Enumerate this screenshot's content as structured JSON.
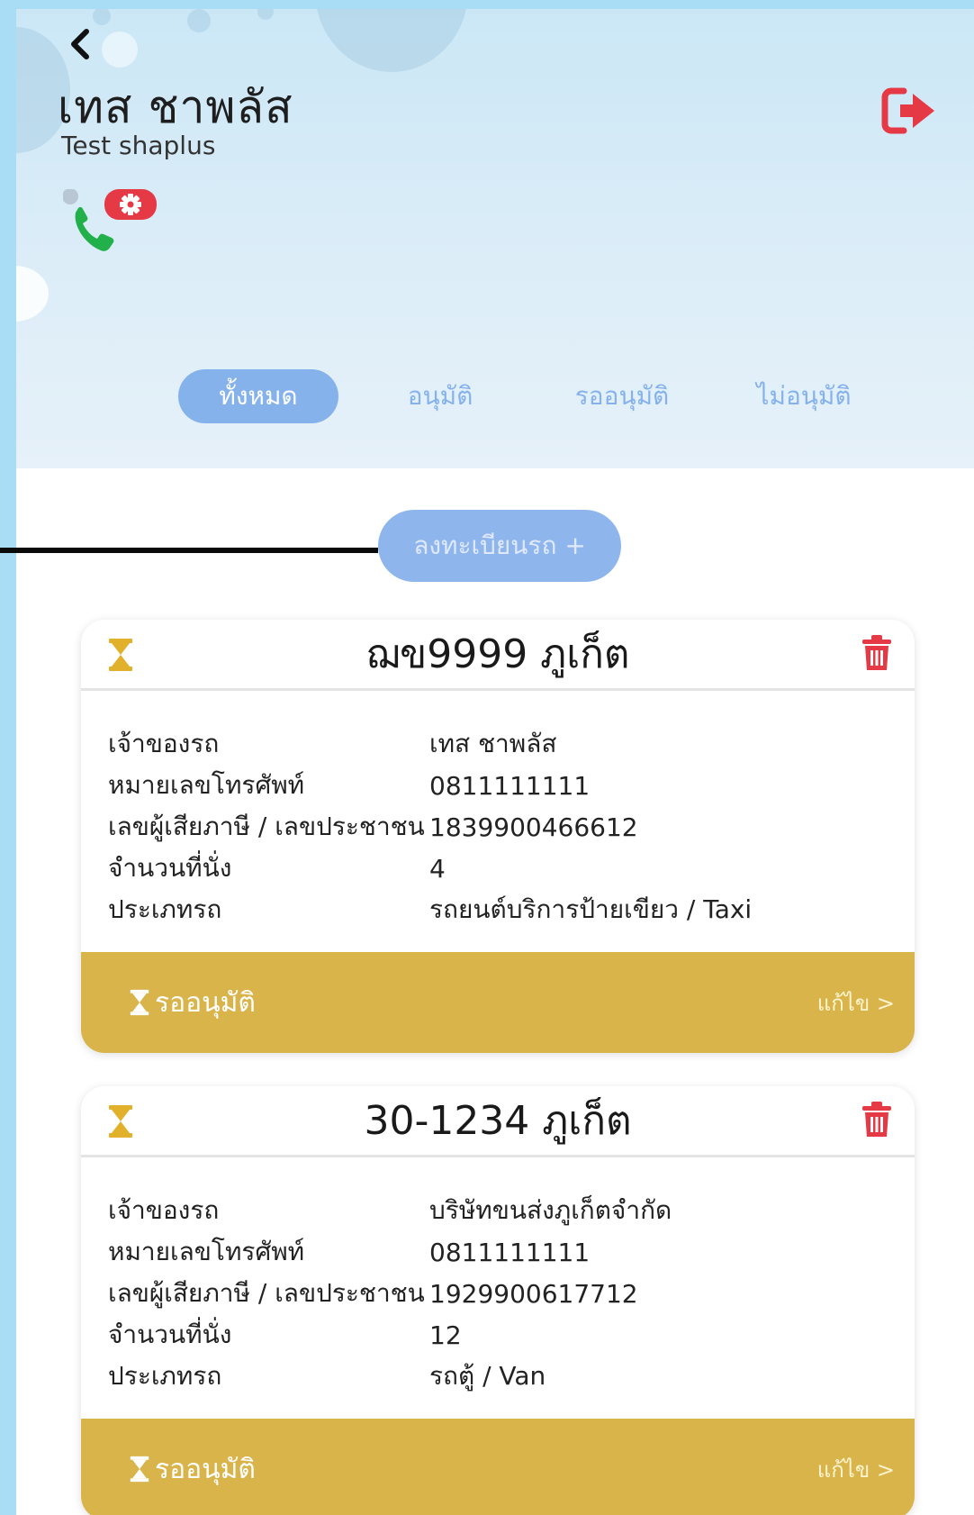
{
  "header": {
    "title": "เทส ชาพลัส",
    "subtitle": "Test shaplus"
  },
  "tabs": [
    {
      "label": "ทั้งหมด",
      "active": true
    },
    {
      "label": "อนุมัติ",
      "active": false
    },
    {
      "label": "รออนุมัติ",
      "active": false
    },
    {
      "label": "ไม่อนุมัติ",
      "active": false
    }
  ],
  "register_button": "ลงทะเบียนรถ +",
  "labels": {
    "owner": "เจ้าของรถ",
    "phone": "หมายเลขโทรศัพท์",
    "tax_id": "เลขผู้เสียภาษี / เลขประชาชน",
    "seats": "จำนวนที่นั่ง",
    "vehicle_type": "ประเภทรถ"
  },
  "vehicles": [
    {
      "plate": "ฌข9999 ภูเก็ต",
      "owner": "เทส ชาพลัส",
      "phone": "0811111111",
      "tax_id": "1839900466612",
      "seats": "4",
      "vehicle_type": "รถยนต์บริการป้ายเขียว / Taxi",
      "status": "รออนุมัติ",
      "edit": "แก้ไข >"
    },
    {
      "plate": "30-1234 ภูเก็ต",
      "owner": "บริษัทขนส่งภูเก็ตจำกัด",
      "phone": "0811111111",
      "tax_id": "1929900617712",
      "seats": "12",
      "vehicle_type": "รถตู้ / Van",
      "status": "รออนุมัติ",
      "edit": "แก้ไข >"
    }
  ],
  "colors": {
    "accent": "#86b2ec",
    "pending": "#d9b44a",
    "danger": "#e53945",
    "phone_green": "#21b04a"
  },
  "icons": {
    "back": "chevron-left-icon",
    "logout": "logout-icon",
    "call": "phone-icon",
    "settings": "gear-icon",
    "pending": "hourglass-icon",
    "delete": "trash-icon"
  }
}
